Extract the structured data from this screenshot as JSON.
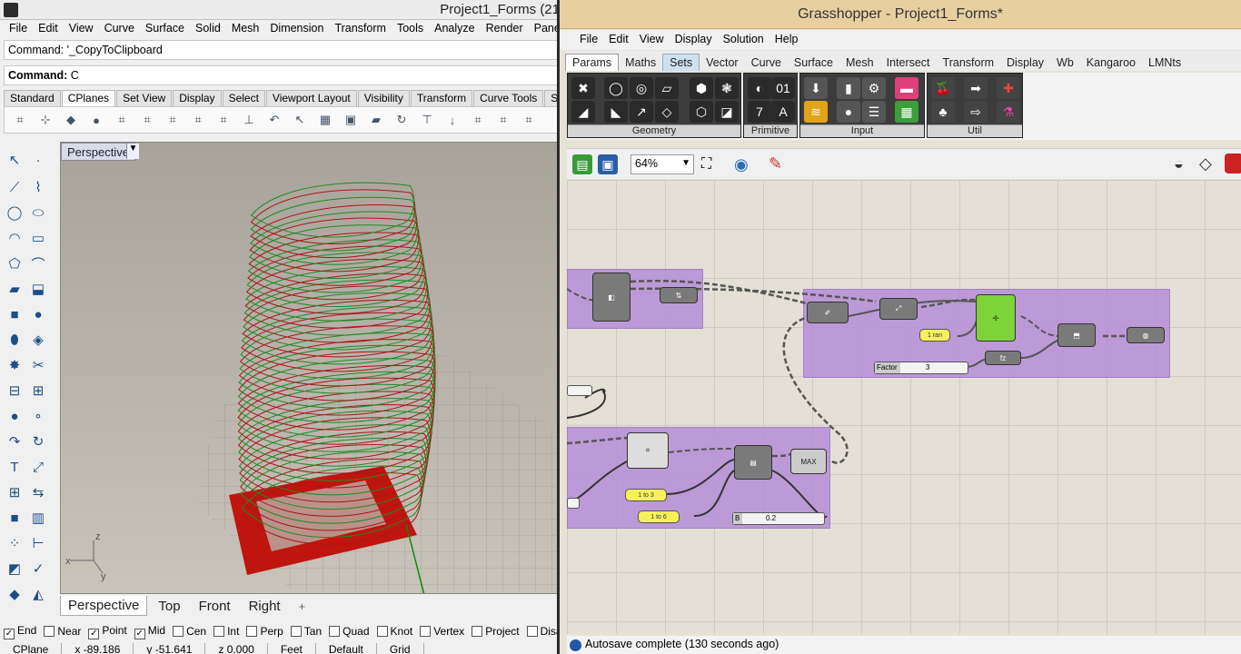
{
  "rhino": {
    "window_title": "Project1_Forms (21",
    "menu": [
      "File",
      "Edit",
      "View",
      "Curve",
      "Surface",
      "Solid",
      "Mesh",
      "Dimension",
      "Transform",
      "Tools",
      "Analyze",
      "Render",
      "Panels"
    ],
    "command_history": "Command: '_CopyToClipboard",
    "command_prompt_label": "Command:",
    "command_prompt_value": "C",
    "toolbar_tabs": [
      "Standard",
      "CPlanes",
      "Set View",
      "Display",
      "Select",
      "Viewport Layout",
      "Visibility",
      "Transform",
      "Curve Tools",
      "Surfa"
    ],
    "active_toolbar_tab": "CPlanes",
    "viewport_label": "Perspective",
    "viewport_tabs": [
      "Perspective",
      "Top",
      "Front",
      "Right"
    ],
    "add_viewport_glyph": "+",
    "osnaps": [
      {
        "label": "End",
        "checked": true
      },
      {
        "label": "Near",
        "checked": false
      },
      {
        "label": "Point",
        "checked": true
      },
      {
        "label": "Mid",
        "checked": true
      },
      {
        "label": "Cen",
        "checked": false
      },
      {
        "label": "Int",
        "checked": false
      },
      {
        "label": "Perp",
        "checked": false
      },
      {
        "label": "Tan",
        "checked": false
      },
      {
        "label": "Quad",
        "checked": false
      },
      {
        "label": "Knot",
        "checked": false
      },
      {
        "label": "Vertex",
        "checked": false
      },
      {
        "label": "Project",
        "checked": false
      },
      {
        "label": "Disa",
        "checked": false
      }
    ],
    "status": {
      "cplane": "CPlane",
      "x": "x -89.186",
      "y": "y -51.641",
      "z": "z 0.000",
      "units": "Feet",
      "layer": "Default",
      "grid": "Grid"
    },
    "axis_labels": {
      "x": "x",
      "y": "y",
      "z": "z"
    }
  },
  "grasshopper": {
    "window_title": "Grasshopper - Project1_Forms*",
    "menu": [
      "File",
      "Edit",
      "View",
      "Display",
      "Solution",
      "Help"
    ],
    "tabs": [
      "Params",
      "Maths",
      "Sets",
      "Vector",
      "Curve",
      "Surface",
      "Mesh",
      "Intersect",
      "Transform",
      "Display",
      "Wb",
      "Kangaroo",
      "LMNts"
    ],
    "selected_tab": "Sets",
    "ribbon_groups": [
      "Geometry",
      "Primitive",
      "Input",
      "Util"
    ],
    "zoom": "64%",
    "status": "Autosave complete (130 seconds ago)",
    "nodes": {
      "factor_slider_label": "Factor",
      "factor_slider_value": "3",
      "b_slider_label": "B",
      "b_slider_value": "0.2",
      "range_1": "1 to 3",
      "range_2": "1 to 6",
      "cherry_panel": "1 ran"
    }
  }
}
